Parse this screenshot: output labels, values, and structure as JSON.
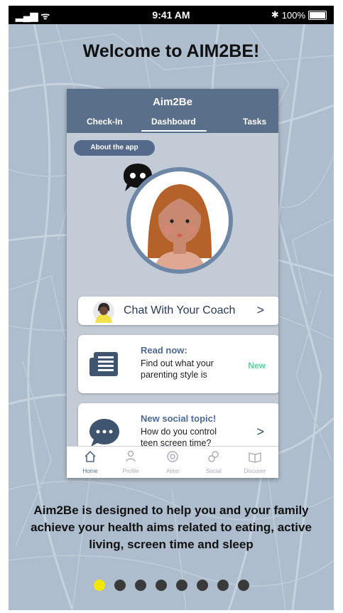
{
  "status_bar": {
    "time": "9:41 AM",
    "battery": "100%"
  },
  "welcome": {
    "title": "Welcome to AIM2BE!"
  },
  "phone": {
    "app_title": "Aim2Be",
    "tabs": [
      {
        "label": "Check-In",
        "active": false
      },
      {
        "label": "Dashboard",
        "active": true
      },
      {
        "label": "Tasks",
        "active": false
      }
    ],
    "about_button": "About the app",
    "coach_card": {
      "label": "Chat With Your Coach",
      "chevron": ">"
    },
    "read_card": {
      "heading": "Read now:",
      "body": "Find out what your parenting style is",
      "badge": "New",
      "icon": "newspaper-icon"
    },
    "social_card": {
      "heading": "New social topic!",
      "body": "How do you control teen screen time?",
      "chevron": ">",
      "icon": "speech-bubble-icon"
    },
    "nav": [
      {
        "label": "Home",
        "icon": "home-icon",
        "active": true
      },
      {
        "label": "Profile",
        "icon": "profile-icon",
        "active": false
      },
      {
        "label": "Aims",
        "icon": "target-icon",
        "active": false
      },
      {
        "label": "Social",
        "icon": "social-icon",
        "active": false
      },
      {
        "label": "Discover",
        "icon": "book-icon",
        "active": false
      }
    ]
  },
  "description": "Aim2Be is designed to help you and your family achieve your health aims related to eating, active living, screen time and sleep",
  "pagination": {
    "total": 8,
    "active_index": 0
  },
  "colors": {
    "background": "#aebdcd",
    "header": "#5a6f8a",
    "accent_new": "#5ed3a0",
    "dot_active": "#f2e700"
  }
}
